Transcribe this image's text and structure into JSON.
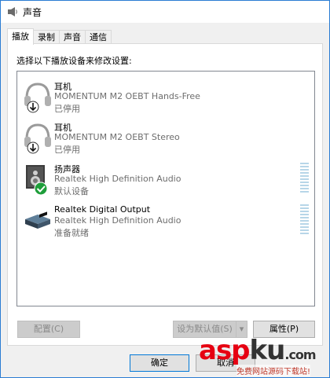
{
  "window": {
    "title": "声音"
  },
  "tabs": [
    {
      "label": "播放",
      "active": true
    },
    {
      "label": "录制",
      "active": false
    },
    {
      "label": "声音",
      "active": false
    },
    {
      "label": "通信",
      "active": false
    }
  ],
  "instruction": "选择以下播放设备来修改设置:",
  "devices": [
    {
      "name": "耳机",
      "description": "MOMENTUM M2 OEBT Hands-Free",
      "status": "已停用",
      "icon": "headphones-icon",
      "badge": "disabled-arrow-badge"
    },
    {
      "name": "耳机",
      "description": "MOMENTUM M2 OEBT Stereo",
      "status": "已停用",
      "icon": "headphones-icon",
      "badge": "disabled-arrow-badge"
    },
    {
      "name": "扬声器",
      "description": "Realtek High Definition Audio",
      "status": "默认设备",
      "icon": "speaker-icon",
      "badge": "default-check-badge"
    },
    {
      "name": "Realtek Digital Output",
      "description": "Realtek High Definition Audio",
      "status": "准备就绪",
      "icon": "digital-output-icon"
    }
  ],
  "buttons": {
    "configure": "配置(C)",
    "set_default": "设为默认值(S)",
    "properties": "属性(P)",
    "ok": "确定",
    "cancel": "取消"
  },
  "watermark": {
    "brand_red": "asp",
    "brand_dark": "ku",
    "brand_suffix": ".com",
    "tagline": "免费网站源码下载站!"
  },
  "colors": {
    "accent": "#0078d7",
    "meter": "#b7d6e8",
    "check": "#1e9e3a",
    "watermark_red": "#e60012"
  }
}
